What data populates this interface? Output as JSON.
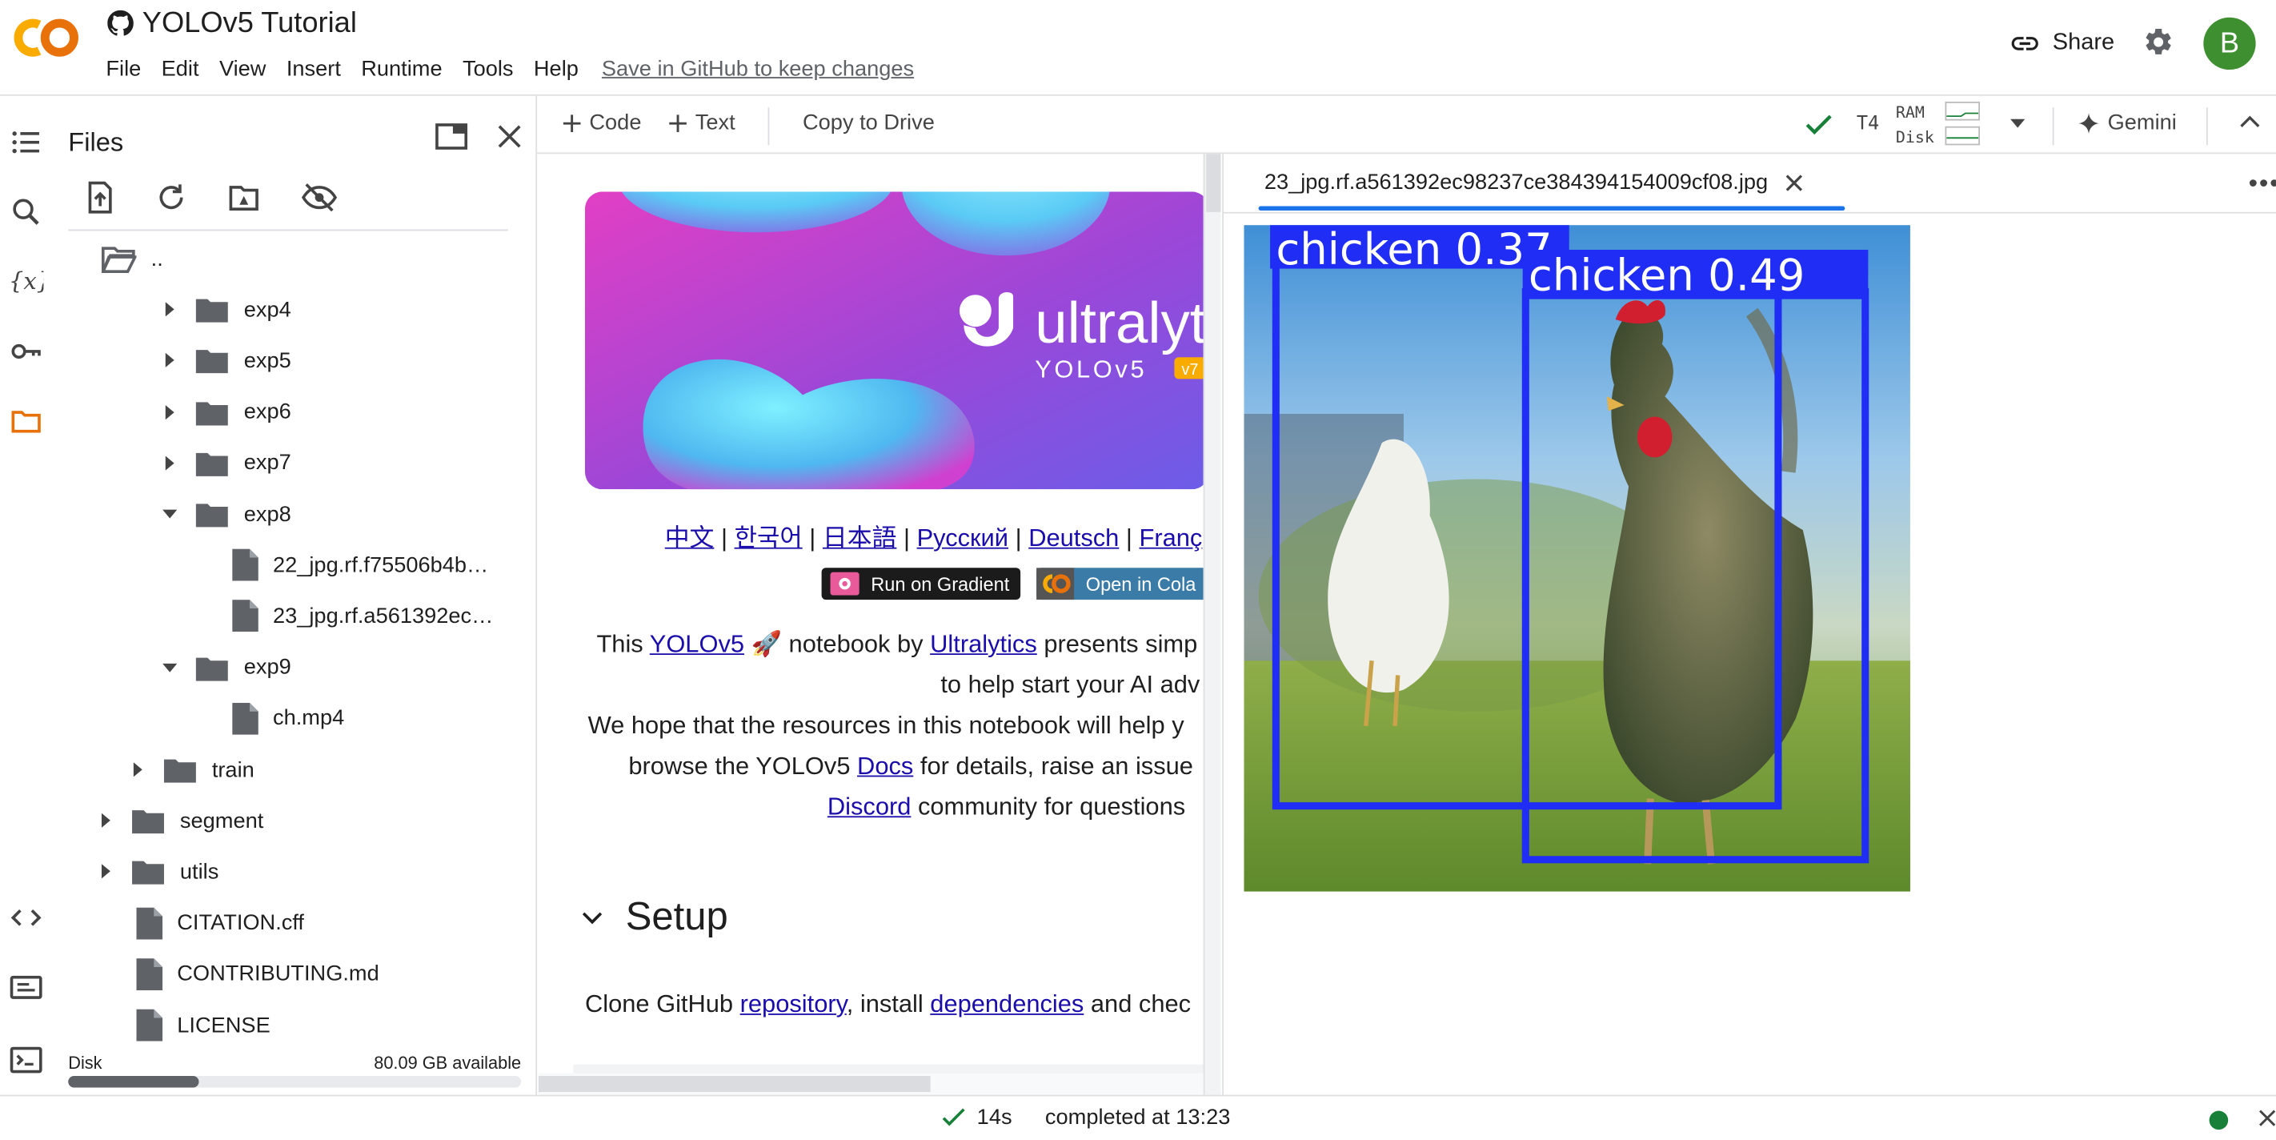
{
  "header": {
    "title": "YOLOv5 Tutorial",
    "menu": [
      "File",
      "Edit",
      "View",
      "Insert",
      "Runtime",
      "Tools",
      "Help"
    ],
    "save_link": "Save in GitHub to keep changes",
    "share_label": "Share",
    "avatar_letter": "B"
  },
  "files_panel": {
    "title": "Files",
    "tree": [
      {
        "label": "..",
        "type": "folder-open"
      },
      {
        "label": "exp4",
        "type": "folder",
        "expanded": false
      },
      {
        "label": "exp5",
        "type": "folder",
        "expanded": false
      },
      {
        "label": "exp6",
        "type": "folder",
        "expanded": false
      },
      {
        "label": "exp7",
        "type": "folder",
        "expanded": false
      },
      {
        "label": "exp8",
        "type": "folder",
        "expanded": true
      },
      {
        "label": "22_jpg.rf.f75506b4b…",
        "type": "file"
      },
      {
        "label": "23_jpg.rf.a561392ec…",
        "type": "file"
      },
      {
        "label": "exp9",
        "type": "folder",
        "expanded": true
      },
      {
        "label": "ch.mp4",
        "type": "file"
      },
      {
        "label": "train",
        "type": "folder",
        "expanded": false
      },
      {
        "label": "segment",
        "type": "folder",
        "expanded": false
      },
      {
        "label": "utils",
        "type": "folder",
        "expanded": false
      },
      {
        "label": "CITATION.cff",
        "type": "file"
      },
      {
        "label": "CONTRIBUTING.md",
        "type": "file"
      },
      {
        "label": "LICENSE",
        "type": "file"
      }
    ],
    "disk_label": "Disk",
    "disk_available": "80.09 GB available",
    "disk_used_fraction": 0.29
  },
  "toolbar": {
    "code_label": "Code",
    "text_label": "Text",
    "copy_label": "Copy to Drive",
    "runtime_type": "T4",
    "ram_label": "RAM",
    "disk_label": "Disk",
    "gemini_label": "Gemini"
  },
  "notebook": {
    "banner_brand": "ultralyt",
    "banner_product": "YOLOv5",
    "banner_version": "v7",
    "languages": [
      "中文",
      "한국어",
      "日本語",
      "Русский",
      "Deutsch",
      "Franç"
    ],
    "separator": "|",
    "badge_gradient": "Run on Gradient",
    "badge_colab": "Open in Cola",
    "p1_a": "This ",
    "p1_link1": "YOLOv5",
    "p1_b": " 🚀 notebook by ",
    "p1_link2": "Ultralytics",
    "p1_c": " presents simp",
    "p2": "to help start your AI adv",
    "p3": "We hope that the resources in this notebook will help y",
    "p4_a": "browse the YOLOv5 ",
    "p4_link": "Docs",
    "p4_b": " for details, raise an issue",
    "p5_link": "Discord",
    "p5_b": " community for questions",
    "setup_heading": "Setup",
    "clone_a": "Clone GitHub ",
    "clone_link1": "repository",
    "clone_b": ", install ",
    "clone_link2": "dependencies",
    "clone_c": " and chec"
  },
  "viewer": {
    "tab_title": "23_jpg.rf.a561392ec98237ce384394154009cf08.jpg",
    "detections": [
      {
        "label": "chicken 0.37"
      },
      {
        "label": "chicken 0.49"
      }
    ],
    "box_color": "#1f2df5"
  },
  "status": {
    "duration": "14s",
    "completed": "completed at 13:23"
  },
  "colors": {
    "accent": "#1a73e8",
    "success": "#188038",
    "colab_orange": "#f9ab00"
  }
}
